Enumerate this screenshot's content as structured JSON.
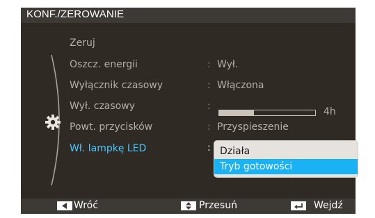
{
  "header": {
    "title": "KONF./ZEROWANIE"
  },
  "menu": [
    {
      "label": "Zeruj",
      "value": ""
    },
    {
      "label": "Oszcz. energii",
      "value": "Wył."
    },
    {
      "label": "Wyłącznik czasowy",
      "value": "Włączona"
    },
    {
      "label": "Wył. czasowy",
      "value": "4h",
      "level": "4h"
    },
    {
      "label": "Powt. przycisków",
      "value": "Przyspieszenie"
    },
    {
      "label": "Wł. lampkę LED",
      "value": ""
    }
  ],
  "separator": ":",
  "dropdown": {
    "options": [
      "Działa",
      "Tryb gotowości"
    ],
    "selected": "Tryb gotowości"
  },
  "slider": {
    "fill_fraction": 0.36
  },
  "footer": {
    "back": {
      "label": "Wróć",
      "icon": "left-arrow-key-icon"
    },
    "move": {
      "label": "Przesuń",
      "icon": "up-down-arrow-key-icon"
    },
    "enter": {
      "label": "Wejdź",
      "icon": "enter-key-icon"
    }
  },
  "colors": {
    "background": "#2f2a23",
    "bar": "#3d3a36",
    "active_text": "#4cc6ff",
    "selection": "#19b2f5"
  }
}
